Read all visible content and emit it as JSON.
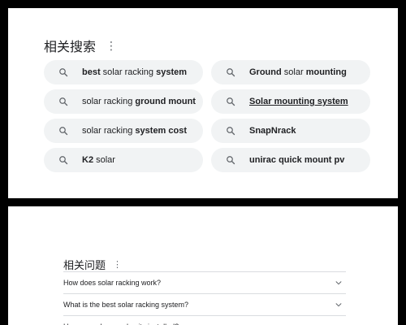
{
  "related_searches": {
    "title": "相关搜索",
    "more_icon": "more-vert-icon",
    "chips": [
      {
        "parts": [
          {
            "t": "best",
            "b": true
          },
          {
            "t": " solar racking ",
            "b": false
          },
          {
            "t": "system",
            "b": true
          }
        ]
      },
      {
        "parts": [
          {
            "t": "Ground",
            "b": true
          },
          {
            "t": " solar ",
            "b": false
          },
          {
            "t": "mounting",
            "b": true
          }
        ]
      },
      {
        "parts": [
          {
            "t": "solar racking ",
            "b": false
          },
          {
            "t": "ground mount",
            "b": true
          }
        ]
      },
      {
        "parts": [
          {
            "t": "Solar mounting system",
            "b": true,
            "u": true
          }
        ]
      },
      {
        "parts": [
          {
            "t": "solar racking ",
            "b": false
          },
          {
            "t": "system cost",
            "b": true
          }
        ]
      },
      {
        "parts": [
          {
            "t": "SnapNrack",
            "b": true
          }
        ]
      },
      {
        "parts": [
          {
            "t": "K2",
            "b": true
          },
          {
            "t": " solar",
            "b": false
          }
        ]
      },
      {
        "parts": [
          {
            "t": "unirac quick mount pv",
            "b": true
          }
        ]
      }
    ]
  },
  "related_questions": {
    "title": "相关问题",
    "more_icon": "more-vert-icon",
    "items": [
      {
        "q": "How does solar racking work?"
      },
      {
        "q": "What is the best solar racking system?"
      },
      {
        "q": "How are solar panel units installed?"
      }
    ]
  },
  "colors": {
    "chip_bg": "#f1f3f4",
    "text": "#202124",
    "icon": "#5f6368",
    "divider": "#dadce0"
  }
}
